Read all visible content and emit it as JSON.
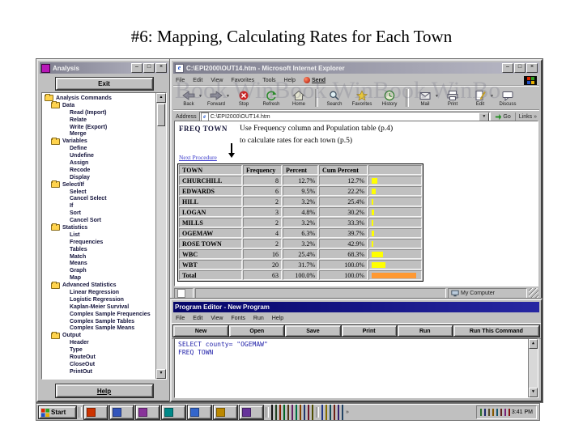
{
  "slide": {
    "title": "#6: Mapping, Calculating Rates for Each Town"
  },
  "analysis": {
    "title": "Analysis",
    "exit_label": "Exit",
    "help_label": "Help",
    "tree": [
      {
        "label": "Analysis Commands",
        "level": 0,
        "icon": "folder"
      },
      {
        "label": "Data",
        "level": 1,
        "icon": "folder"
      },
      {
        "label": "Read (Import)",
        "level": 2,
        "icon": "none"
      },
      {
        "label": "Relate",
        "level": 2,
        "icon": "none"
      },
      {
        "label": "Write (Export)",
        "level": 2,
        "icon": "none"
      },
      {
        "label": "Merge",
        "level": 2,
        "icon": "none"
      },
      {
        "label": "Variables",
        "level": 1,
        "icon": "folder"
      },
      {
        "label": "Define",
        "level": 2,
        "icon": "none"
      },
      {
        "label": "Undefine",
        "level": 2,
        "icon": "none"
      },
      {
        "label": "Assign",
        "level": 2,
        "icon": "none"
      },
      {
        "label": "Recode",
        "level": 2,
        "icon": "none"
      },
      {
        "label": "Display",
        "level": 2,
        "icon": "none"
      },
      {
        "label": "Select/If",
        "level": 1,
        "icon": "folder"
      },
      {
        "label": "Select",
        "level": 2,
        "icon": "none"
      },
      {
        "label": "Cancel Select",
        "level": 2,
        "icon": "none"
      },
      {
        "label": "If",
        "level": 2,
        "icon": "none"
      },
      {
        "label": "Sort",
        "level": 2,
        "icon": "none"
      },
      {
        "label": "Cancel Sort",
        "level": 2,
        "icon": "none"
      },
      {
        "label": "Statistics",
        "level": 1,
        "icon": "folder"
      },
      {
        "label": "List",
        "level": 2,
        "icon": "none"
      },
      {
        "label": "Frequencies",
        "level": 2,
        "icon": "none"
      },
      {
        "label": "Tables",
        "level": 2,
        "icon": "none"
      },
      {
        "label": "Match",
        "level": 2,
        "icon": "none"
      },
      {
        "label": "Means",
        "level": 2,
        "icon": "none"
      },
      {
        "label": "Graph",
        "level": 2,
        "icon": "none"
      },
      {
        "label": "Map",
        "level": 2,
        "icon": "none"
      },
      {
        "label": "Advanced Statistics",
        "level": 1,
        "icon": "folder"
      },
      {
        "label": "Linear Regression",
        "level": 2,
        "icon": "none"
      },
      {
        "label": "Logistic Regression",
        "level": 2,
        "icon": "none"
      },
      {
        "label": "Kaplan-Meier Survival",
        "level": 2,
        "icon": "none"
      },
      {
        "label": "Complex Sample Frequencies",
        "level": 2,
        "icon": "none"
      },
      {
        "label": "Complex Sample Tables",
        "level": 2,
        "icon": "none"
      },
      {
        "label": "Complex Sample Means",
        "level": 2,
        "icon": "none"
      },
      {
        "label": "Output",
        "level": 1,
        "icon": "folder"
      },
      {
        "label": "Header",
        "level": 2,
        "icon": "none"
      },
      {
        "label": "Type",
        "level": 2,
        "icon": "none"
      },
      {
        "label": "RouteOut",
        "level": 2,
        "icon": "none"
      },
      {
        "label": "CloseOut",
        "level": 2,
        "icon": "none"
      },
      {
        "label": "PrintOut",
        "level": 2,
        "icon": "none"
      }
    ]
  },
  "ie": {
    "title": "C:\\EPI2000\\OUT14.htm - Microsoft Internet Explorer",
    "menu": [
      "File",
      "Edit",
      "View",
      "Favorites",
      "Tools",
      "Help"
    ],
    "send_label": "Send",
    "toolbar": [
      {
        "label": "Back",
        "icon": "back-icon",
        "dropdown": true
      },
      {
        "label": "Forward",
        "icon": "forward-icon",
        "dropdown": true
      },
      {
        "label": "Stop",
        "icon": "stop-icon"
      },
      {
        "label": "Refresh",
        "icon": "refresh-icon"
      },
      {
        "label": "Home",
        "icon": "home-icon",
        "sep_after": true
      },
      {
        "label": "Search",
        "icon": "search-icon"
      },
      {
        "label": "Favorites",
        "icon": "favorites-icon"
      },
      {
        "label": "History",
        "icon": "history-icon",
        "sep_after": true
      },
      {
        "label": "Mail",
        "icon": "mail-icon",
        "dropdown": true
      },
      {
        "label": "Print",
        "icon": "print-icon"
      },
      {
        "label": "Edit",
        "icon": "edit-icon",
        "dropdown": true
      },
      {
        "label": "Discuss",
        "icon": "discuss-icon"
      }
    ],
    "address_label": "Address",
    "address_value": "C:\\EPI2000\\OUT14.htm",
    "go_label": "Go",
    "links_label": "Links",
    "status_text": "My Computer",
    "watermark": "Book WinBook WinBook WinBo"
  },
  "content": {
    "heading": "FREQ TOWN",
    "annotation_line1": "Use Frequency column and Population table (p.4)",
    "annotation_line2": "to calculate rates for each town (p.5)",
    "link_label": "Next Procedure",
    "table": {
      "headers": [
        "TOWN",
        "Frequency",
        "Percent",
        "Cum Percent"
      ],
      "bar_colors": {
        "row": "#ffff00",
        "total": "#ff9933"
      },
      "rows": [
        {
          "town": "CHURCHILL",
          "frequency": "8",
          "percent": "12.7%",
          "cum": "12.7%",
          "bar_pct": 12.7,
          "total": false
        },
        {
          "town": "EDWARDS",
          "frequency": "6",
          "percent": "9.5%",
          "cum": "22.2%",
          "bar_pct": 9.5,
          "total": false
        },
        {
          "town": "HILL",
          "frequency": "2",
          "percent": "3.2%",
          "cum": "25.4%",
          "bar_pct": 3.2,
          "total": false
        },
        {
          "town": "LOGAN",
          "frequency": "3",
          "percent": "4.8%",
          "cum": "30.2%",
          "bar_pct": 4.8,
          "total": false
        },
        {
          "town": "MILLS",
          "frequency": "2",
          "percent": "3.2%",
          "cum": "33.3%",
          "bar_pct": 3.2,
          "total": false
        },
        {
          "town": "OGEMAW",
          "frequency": "4",
          "percent": "6.3%",
          "cum": "39.7%",
          "bar_pct": 6.3,
          "total": false
        },
        {
          "town": "ROSE TOWN",
          "frequency": "2",
          "percent": "3.2%",
          "cum": "42.9%",
          "bar_pct": 3.2,
          "total": false
        },
        {
          "town": "WBC",
          "frequency": "16",
          "percent": "25.4%",
          "cum": "68.3%",
          "bar_pct": 25.4,
          "total": false
        },
        {
          "town": "WBT",
          "frequency": "20",
          "percent": "31.7%",
          "cum": "100.0%",
          "bar_pct": 31.7,
          "total": false
        },
        {
          "town": "Total",
          "frequency": "63",
          "percent": "100.0%",
          "cum": "100.0%",
          "bar_pct": 100,
          "total": true
        }
      ]
    }
  },
  "program_editor": {
    "title": "Program Editor - New Program",
    "menu": [
      "File",
      "Edit",
      "View",
      "Fonts",
      "Run",
      "Help"
    ],
    "buttons": [
      "New",
      "Open",
      "Save",
      "Print",
      "Run",
      "Run This Command"
    ],
    "code_lines": [
      "SELECT county= \"OGEMAW\"",
      "FREQ  TOWN"
    ]
  },
  "taskbar": {
    "start_label": "Start",
    "clock": "3:41 PM",
    "task_button_colors": [
      "#cc3300",
      "#3355bb",
      "#883399",
      "#008888",
      "#3366cc",
      "#bb8800",
      "#663399"
    ],
    "strip1_colors": [
      "#222222",
      "#336633",
      "#cc3300",
      "#009933",
      "#775522",
      "#993399",
      "#00aa66",
      "#cc6600",
      "#3355aa",
      "#aa2244",
      "#777700"
    ],
    "strip2_colors": [
      "#3355cc",
      "#ccaa00",
      "#227788",
      "#aa3322",
      "#5533aa",
      "#336699"
    ],
    "tray_colors": [
      "#44aa44",
      "#3344aa",
      "#887744",
      "#cc8800",
      "#2288aa",
      "#993333",
      "#bb33bb",
      "#cc2222"
    ]
  }
}
